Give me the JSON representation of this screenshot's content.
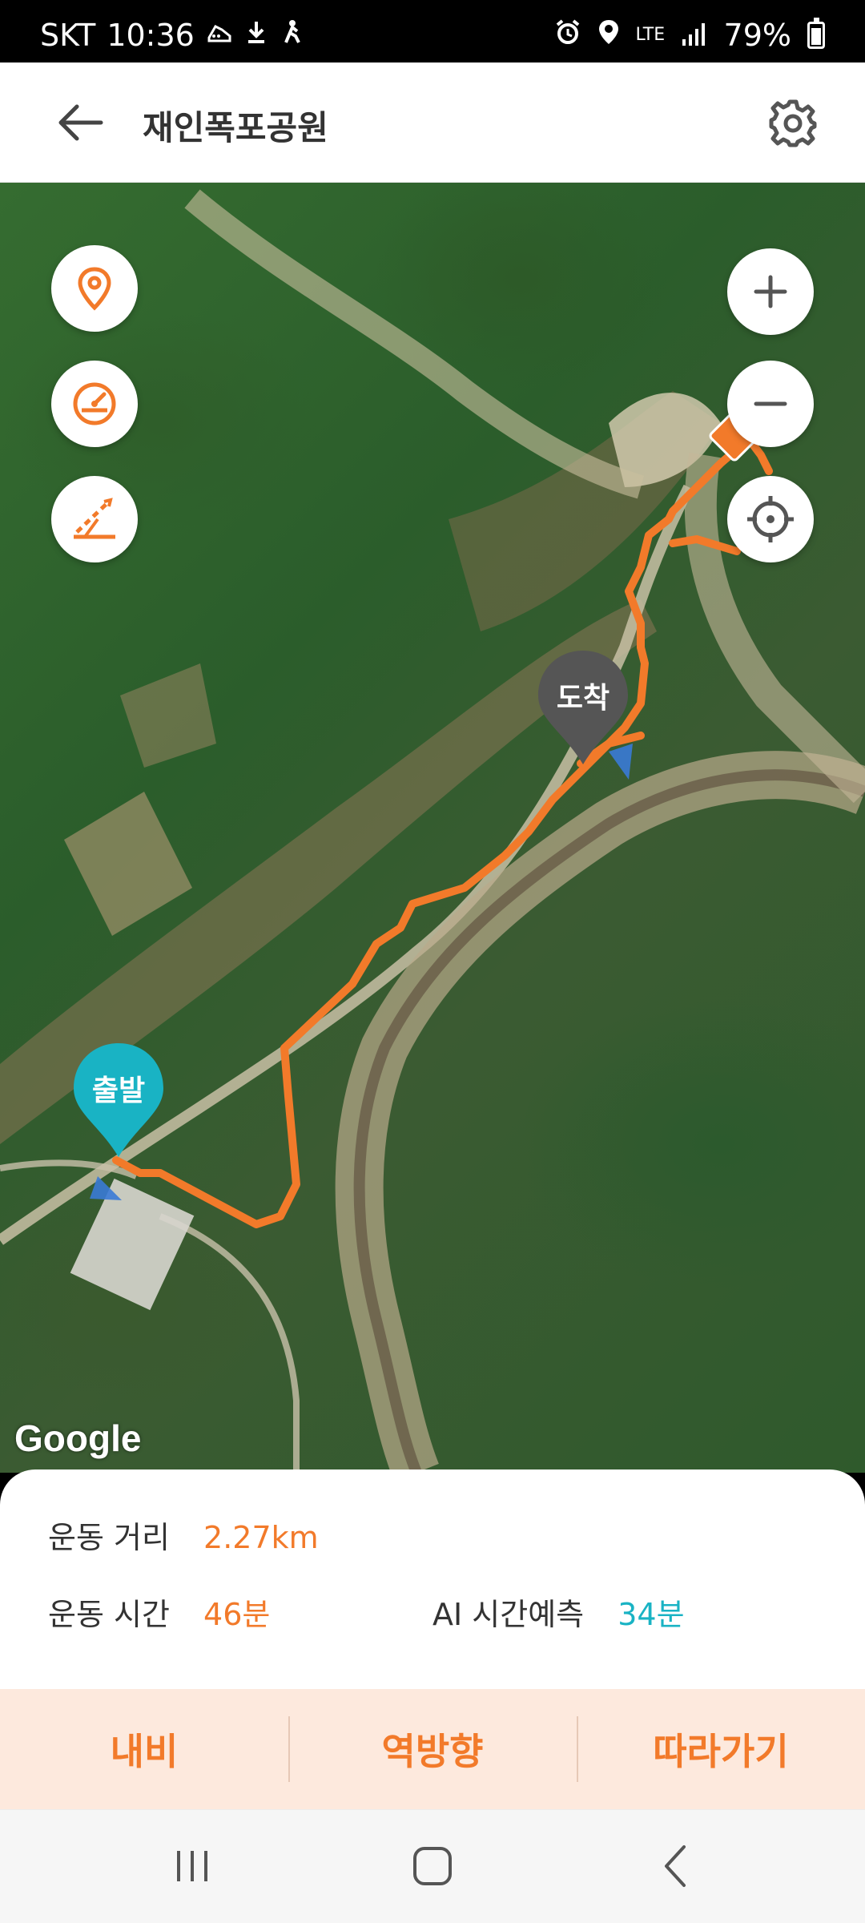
{
  "status_bar": {
    "carrier": "SKT",
    "time": "10:36",
    "network": "LTE",
    "battery": "79%",
    "icons": [
      "shoe-icon",
      "download-icon",
      "hiker-icon",
      "alarm-icon",
      "location-icon",
      "signal-icon",
      "battery-icon"
    ]
  },
  "header": {
    "title": "재인폭포공원",
    "back_icon": "arrow-left-icon",
    "settings_icon": "gear-icon"
  },
  "map": {
    "attribution": "Google",
    "start_marker": "출발",
    "end_marker": "도착",
    "left_controls": [
      "location-pin-icon",
      "speedometer-icon",
      "elevation-icon"
    ],
    "right_controls": [
      "plus-icon",
      "minus-icon",
      "crosshair-icon"
    ],
    "colors": {
      "route": "#f27a2a",
      "start_pin": "#19b3c4",
      "end_pin": "#555555"
    }
  },
  "stats": {
    "distance_label": "운동 거리",
    "distance_value": "2.27km",
    "time_label": "운동 시간",
    "time_value": "46분",
    "ai_label": "AI 시간예측",
    "ai_value": "34분"
  },
  "actions": {
    "navi": "내비",
    "reverse": "역방향",
    "follow": "따라가기"
  },
  "nav": {
    "recents_icon": "recents-icon",
    "home_icon": "home-icon",
    "back_icon": "back-chevron-icon"
  },
  "colors": {
    "accent": "#f27a2a",
    "teal": "#19b3c4",
    "action_bg": "#fde9dd"
  }
}
